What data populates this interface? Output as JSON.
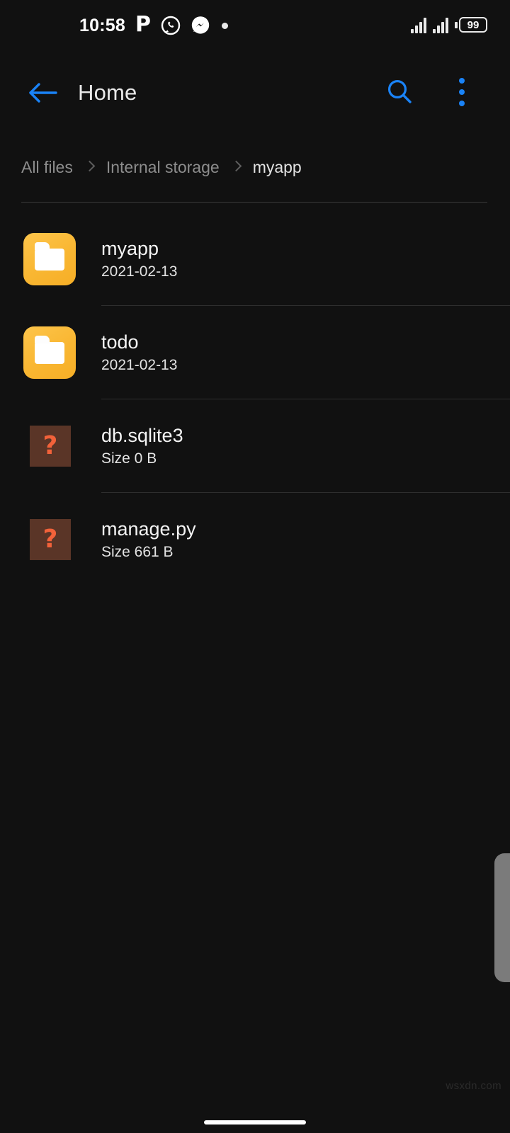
{
  "status_bar": {
    "time": "10:58",
    "icons": [
      {
        "name": "p-app-icon",
        "glyph": "P"
      },
      {
        "name": "whatsapp-icon",
        "glyph": "whatsapp"
      },
      {
        "name": "messenger-icon",
        "glyph": "messenger"
      },
      {
        "name": "dot-indicator-icon",
        "glyph": "dot"
      }
    ],
    "signal_bars_count": 2,
    "signal_strength": 4,
    "battery_level": "99"
  },
  "app_bar": {
    "back_label": "back",
    "title": "Home",
    "search_label": "search",
    "menu_label": "more options"
  },
  "breadcrumb": {
    "items": [
      {
        "label": "All files",
        "active": false
      },
      {
        "label": "Internal storage",
        "active": false
      },
      {
        "label": "myapp",
        "active": true
      }
    ]
  },
  "files": [
    {
      "name": "myapp",
      "meta": "2021-02-13",
      "type": "folder",
      "icon": "folder-icon"
    },
    {
      "name": "todo",
      "meta": "2021-02-13",
      "type": "folder",
      "icon": "folder-icon"
    },
    {
      "name": "db.sqlite3",
      "meta": "Size 0 B",
      "type": "unknown",
      "icon": "unknown-file-icon",
      "glyph": "?"
    },
    {
      "name": "manage.py",
      "meta": "Size 661 B",
      "type": "unknown",
      "icon": "unknown-file-icon",
      "glyph": "?"
    }
  ],
  "watermark": "wsxdn.com",
  "colors": {
    "background": "#111111",
    "accent_blue": "#1a83f7",
    "folder_amber": "#f9b733",
    "unknown_brown": "#5a3527",
    "unknown_question": "#f2623a",
    "title_text": "#f4f4f4",
    "muted_text": "#8d8d8d",
    "divider": "#2e2e2e",
    "scroll_handle": "#7b7b7b"
  }
}
